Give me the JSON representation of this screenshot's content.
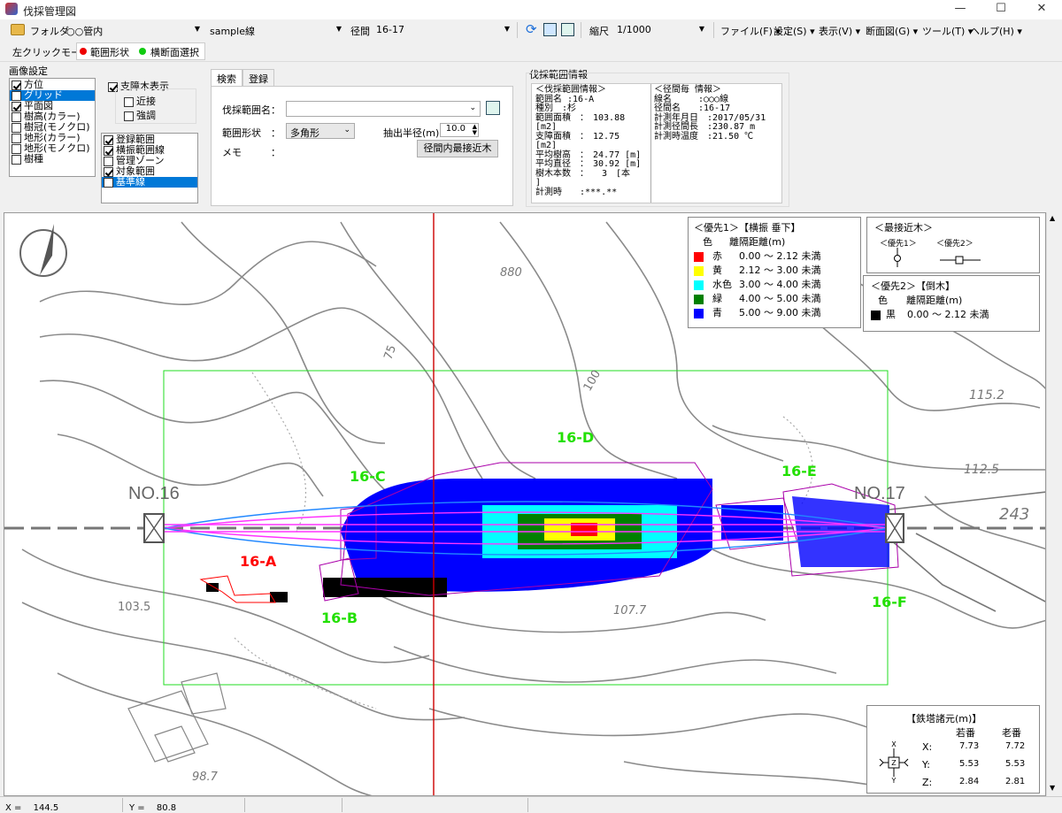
{
  "window": {
    "title": "伐採管理図"
  },
  "toolbar": {
    "folder_label": "フォルダ",
    "folder_value": "○○管内",
    "line_value": "sample線",
    "span_label": "径間",
    "span_value": "16-17",
    "scale_label": "縮尺",
    "scale_value": "1/1000",
    "menus": [
      "ファイル(F)",
      "設定(S)",
      "表示(V)",
      "断面図(G)",
      "ツール(T)",
      "ヘルプ(H)"
    ]
  },
  "modebar": {
    "mode_label": "左クリックモード",
    "range_shape": "範囲形状",
    "cross_section": "横断面選択"
  },
  "image_settings": {
    "group_label": "画像設定",
    "layers": [
      {
        "label": "方位",
        "checked": true,
        "selected": false
      },
      {
        "label": "グリッド",
        "checked": false,
        "selected": true
      },
      {
        "label": "平面図",
        "checked": true,
        "selected": false
      },
      {
        "label": "樹高(カラー)",
        "checked": false,
        "selected": false
      },
      {
        "label": "樹冠(モノクロ)",
        "checked": false,
        "selected": false
      },
      {
        "label": "地形(カラー)",
        "checked": false,
        "selected": false
      },
      {
        "label": "地形(モノクロ)",
        "checked": false,
        "selected": false
      },
      {
        "label": "樹種",
        "checked": false,
        "selected": false
      }
    ],
    "support_tree": {
      "label": "支障木表示",
      "checked": true,
      "near": "近接",
      "emphasis": "強調"
    },
    "ranges": [
      {
        "label": "登録範囲",
        "checked": true,
        "selected": false
      },
      {
        "label": "横振範囲線",
        "checked": true,
        "selected": false
      },
      {
        "label": "管理ゾーン",
        "checked": false,
        "selected": false
      },
      {
        "label": "対象範囲",
        "checked": true,
        "selected": false
      },
      {
        "label": "基準線",
        "checked": false,
        "selected": true
      }
    ]
  },
  "search_tabs": [
    "検索",
    "登録"
  ],
  "search": {
    "name_label": "伐採範囲名：",
    "shape_label": "範囲形状　：",
    "shape_value": "多角形",
    "radius_label": "抽出半径(m)",
    "radius_value": "10.0",
    "memo_label": "メモ　　　：",
    "nearest_button": "径間内最接近木"
  },
  "info": {
    "group_label": "伐採範囲情報",
    "range_text": "＜伐採範囲情報＞\n範囲名 :16-A\n種別　:杉\n範囲面積　：　103.88\n[m2]\n支障面積　：　12.75\n[m2]\n平均樹高　：　24.77 [m]\n平均直径　：　30.92 [m]\n樹木本数　：　　3　[本\n]\n計測時　　:***.**",
    "span_text": "＜径間毎 情報＞\n線名　　　:○○○線\n径間名　　:16-17\n計測年月日　:2017/05/31\n計測径間長　:230.87 m\n計測時温度　:21.50 ℃"
  },
  "map": {
    "tower_left": "NO.16",
    "tower_right": "NO.17",
    "area_labels": [
      {
        "text": "16-A",
        "color": "#ff0000"
      },
      {
        "text": "16-B",
        "color": "#22e000"
      },
      {
        "text": "16-C",
        "color": "#22e000"
      },
      {
        "text": "16-D",
        "color": "#22e000"
      },
      {
        "text": "16-E",
        "color": "#22e000"
      },
      {
        "text": "16-F",
        "color": "#22e000"
      }
    ],
    "contours": [
      "880",
      "75",
      "100",
      "115.2",
      "112.5",
      "243",
      "103.5",
      "107.7",
      "98.7"
    ]
  },
  "legend1": {
    "title": "＜優先1＞【横振 垂下】",
    "col_color": "色",
    "col_dist": "離隔距離(m)",
    "rows": [
      {
        "swatch": "#ff0000",
        "name": "赤",
        "range": "0.00 ～ 2.12 未満"
      },
      {
        "swatch": "#ffff00",
        "name": "黄",
        "range": "2.12 ～ 3.00 未満"
      },
      {
        "swatch": "#00ffff",
        "name": "水色",
        "range": "3.00 ～ 4.00 未満"
      },
      {
        "swatch": "#008000",
        "name": "緑",
        "range": "4.00 ～ 5.00 未満"
      },
      {
        "swatch": "#0000ff",
        "name": "青",
        "range": "5.00 ～ 9.00 未満"
      }
    ]
  },
  "legend_nearest": {
    "title": "＜最接近木＞",
    "p1": "＜優先1＞",
    "p2": "＜優先2＞"
  },
  "legend2": {
    "title": "＜優先2＞【倒木】",
    "col_color": "色",
    "col_dist": "離隔距離(m)",
    "row": {
      "swatch": "#000000",
      "name": "黒",
      "range": "0.00 ～ 2.12 未満"
    }
  },
  "tower_spec": {
    "title": "【鉄塔諸元(m)】",
    "col1": "若番",
    "col2": "老番",
    "rows": [
      {
        "axis": "X:",
        "v1": "7.73",
        "v2": "7.72"
      },
      {
        "axis": "Y:",
        "v1": "5.53",
        "v2": "5.53"
      },
      {
        "axis": "Z:",
        "v1": "2.84",
        "v2": "2.81"
      }
    ]
  },
  "status": {
    "x": "X = 　144.5",
    "y": "Y = 　80.8"
  }
}
